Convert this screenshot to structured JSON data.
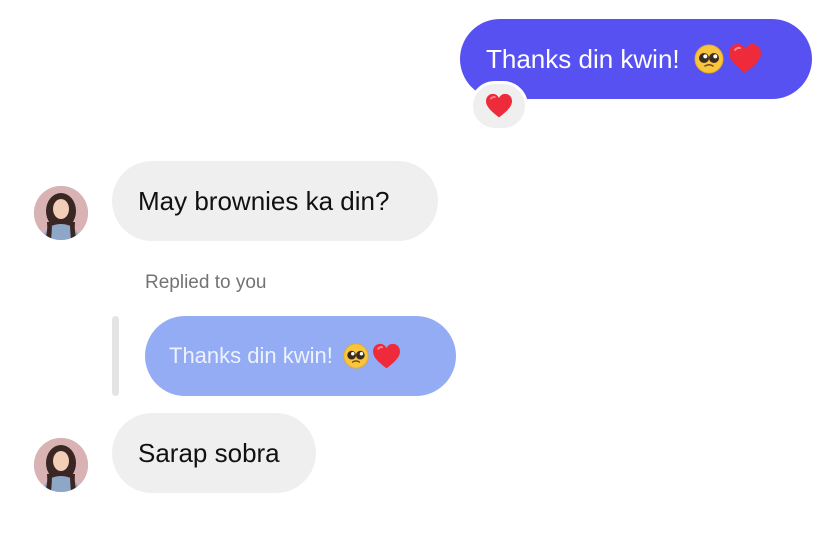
{
  "conversation": {
    "messages": [
      {
        "sender": "me",
        "text": "Thanks din kwin!",
        "emojis": [
          "pleading-face",
          "red-heart"
        ],
        "reaction": "red-heart"
      },
      {
        "sender": "contact",
        "text": "May brownies ka din?"
      },
      {
        "sender": "contact",
        "reply_label": "Replied to you",
        "quoted_text": "Thanks din kwin!",
        "quoted_emojis": [
          "pleading-face",
          "red-heart"
        ],
        "text": "Sarap sobra"
      }
    ]
  },
  "colors": {
    "sent_bubble": "#5651f0",
    "received_bubble": "#efefef",
    "quoted_bubble": "#93acf4",
    "reply_label": "#737373"
  },
  "icons": {
    "avatar": "contact-avatar",
    "reaction": "red-heart-icon",
    "emoji_1": "pleading-face-icon",
    "emoji_2": "red-heart-icon"
  }
}
